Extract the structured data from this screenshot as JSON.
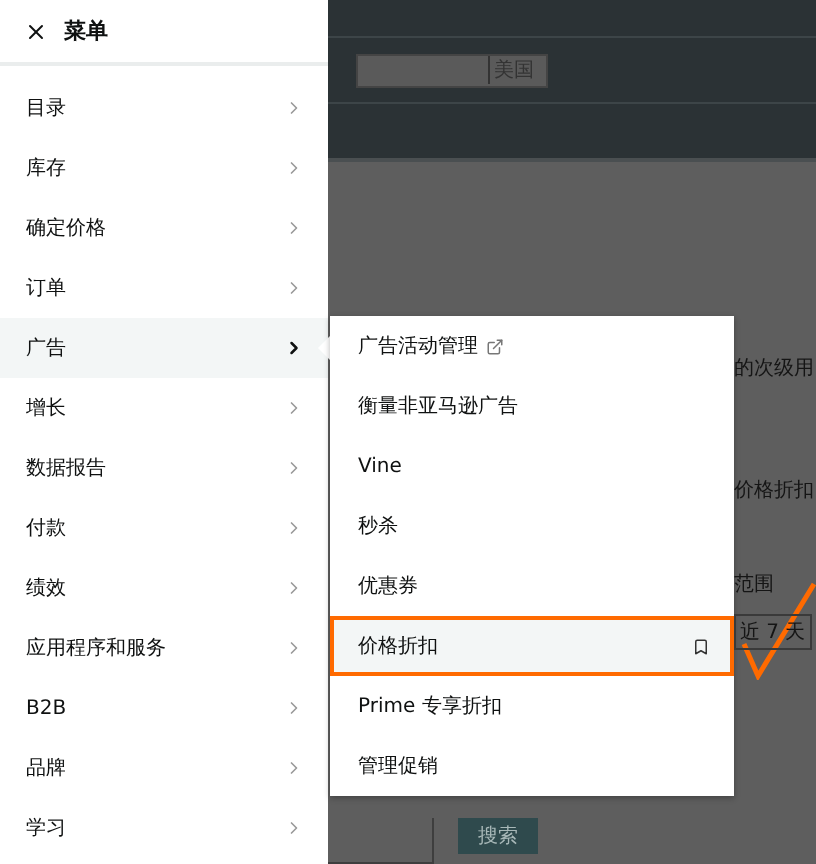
{
  "menu": {
    "title": "菜单",
    "items": [
      {
        "label": "目录",
        "selected": false
      },
      {
        "label": "库存",
        "selected": false
      },
      {
        "label": "确定价格",
        "selected": false
      },
      {
        "label": "订单",
        "selected": false
      },
      {
        "label": "广告",
        "selected": true
      },
      {
        "label": "增长",
        "selected": false
      },
      {
        "label": "数据报告",
        "selected": false
      },
      {
        "label": "付款",
        "selected": false
      },
      {
        "label": "绩效",
        "selected": false
      },
      {
        "label": "应用程序和服务",
        "selected": false
      },
      {
        "label": "B2B",
        "selected": false
      },
      {
        "label": "品牌",
        "selected": false
      },
      {
        "label": "学习",
        "selected": false
      }
    ]
  },
  "submenu": {
    "items": [
      {
        "label": "广告活动管理",
        "external": true,
        "selected": false
      },
      {
        "label": "衡量非亚马逊广告",
        "external": false,
        "selected": false
      },
      {
        "label": "Vine",
        "external": false,
        "selected": false
      },
      {
        "label": "秒杀",
        "external": false,
        "selected": false
      },
      {
        "label": "优惠券",
        "external": false,
        "selected": false
      },
      {
        "label": "价格折扣",
        "external": false,
        "selected": true
      },
      {
        "label": "Prime 专享折扣",
        "external": false,
        "selected": false
      },
      {
        "label": "管理促销",
        "external": false,
        "selected": false
      }
    ]
  },
  "background": {
    "region": "美国",
    "text_1": "的次级用",
    "text_2": "价格折扣",
    "text_3": "范围",
    "date_range": "近 7 天",
    "search_button": "搜索"
  }
}
